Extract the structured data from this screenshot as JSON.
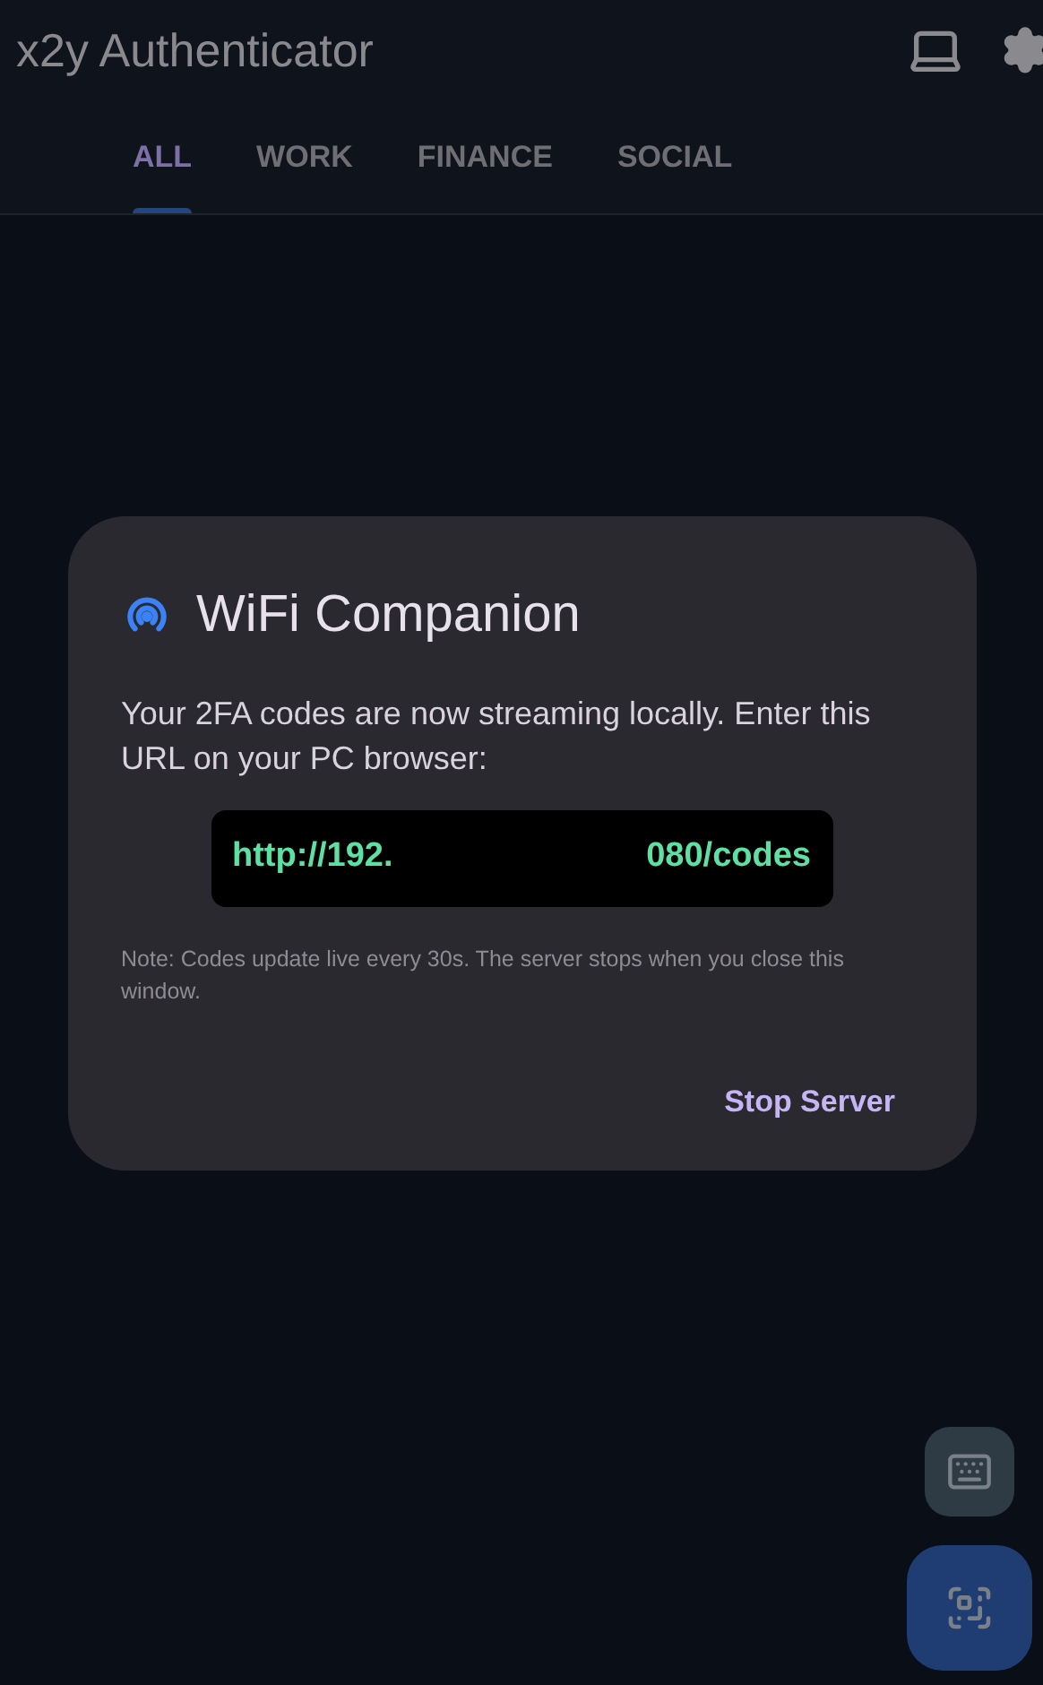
{
  "app_bar": {
    "title": "x2y Authenticator"
  },
  "tabs": [
    {
      "label": "ALL",
      "selected": true
    },
    {
      "label": "WORK",
      "selected": false
    },
    {
      "label": "FINANCE",
      "selected": false
    },
    {
      "label": "SOCIAL",
      "selected": false
    }
  ],
  "dialog": {
    "title": "WiFi Companion",
    "message": "Your 2FA codes are now streaming locally. Enter this URL on your PC browser:",
    "url_start": "http://192.",
    "url_end": "080/codes",
    "note": "Note: Codes update live every 30s. The server stops when you close this window.",
    "action": "Stop Server"
  }
}
